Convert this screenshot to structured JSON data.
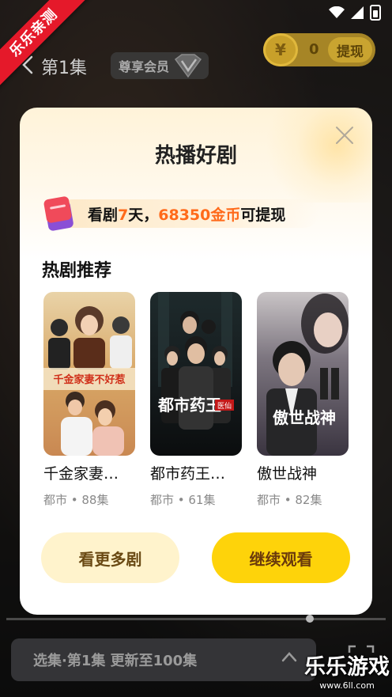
{
  "watermark_ribbon": "乐乐亲测",
  "top_nav": {
    "episode_title": "第1集",
    "vip_label": "尊享会员",
    "coin_symbol": "¥",
    "coin_count": "0",
    "withdraw_label": "提现"
  },
  "modal": {
    "title": "热播好剧",
    "promo": {
      "prefix": "看剧",
      "days": "7",
      "mid": "天，",
      "coins": "68350金币",
      "suffix": "可提现"
    },
    "section_title": "热剧推荐",
    "dramas": [
      {
        "name": "千金家妻…",
        "meta": "都市 • 88集",
        "poster_text": "千金家妻不好惹"
      },
      {
        "name": "都市药王…",
        "meta": "都市 • 61集",
        "poster_text": "都市药王",
        "poster_tag": "医仙"
      },
      {
        "name": "傲世战神",
        "meta": "都市 • 82集",
        "poster_text": "傲世战神"
      }
    ],
    "btn_more": "看更多剧",
    "btn_continue": "继续观看"
  },
  "bottom": {
    "episode_selector": "选集·第1集  更新至100集",
    "progress": 0.8
  },
  "site_watermark": {
    "title": "乐乐游戏",
    "url": "www.6ll.com"
  },
  "colors": {
    "accent_yellow": "#fed30a",
    "highlight_orange": "#ff6a1a",
    "ribbon_red": "#e5192a"
  }
}
